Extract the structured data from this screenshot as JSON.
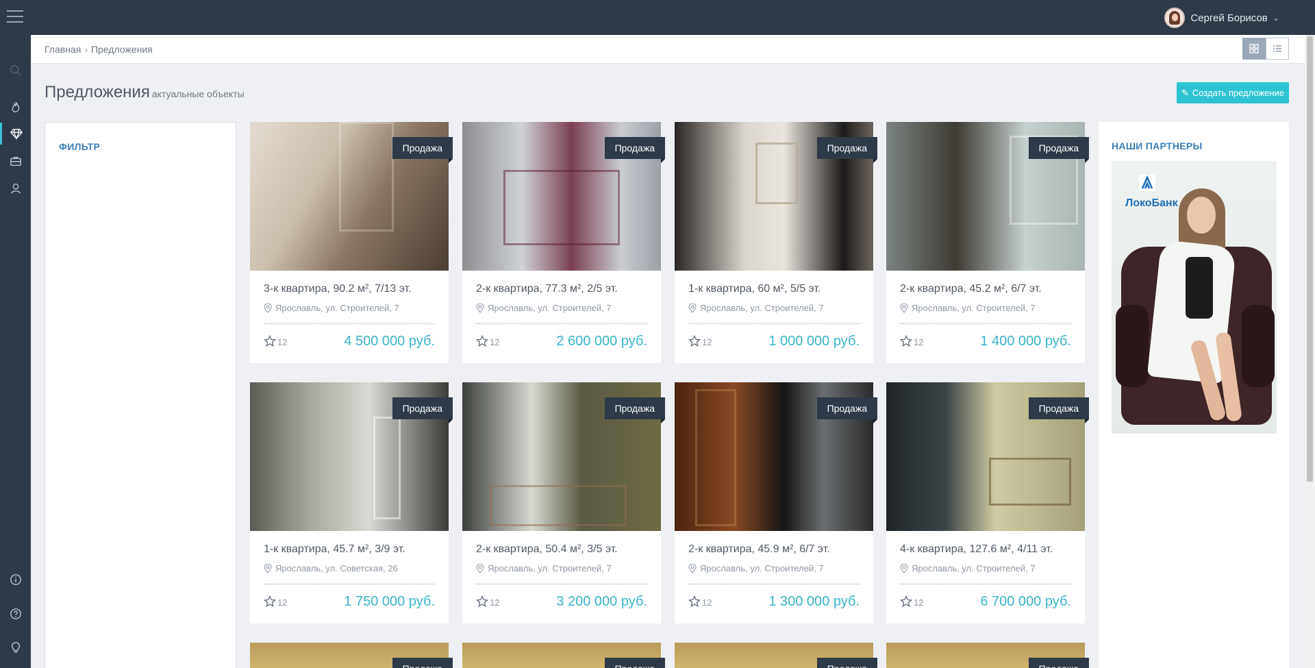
{
  "user": {
    "name": "Сергей Борисов"
  },
  "breadcrumb": {
    "home": "Главная",
    "current": "Предложения"
  },
  "page": {
    "title": "Предложения",
    "subtitle": "актуальные объекты",
    "create_label": "Создать предложение"
  },
  "filter": {
    "title": "ФИЛЬТР"
  },
  "partners": {
    "title": "НАШИ ПАРТНЕРЫ",
    "bank_name": "ЛокоБанк"
  },
  "colors": {
    "topbar": "#2e3a48",
    "accent": "#2ec3d4",
    "price": "#39b3ca",
    "heading": "#3a7fb8"
  },
  "sidebar_icons": [
    "search-icon",
    "fire-icon",
    "diamond-icon",
    "briefcase-icon",
    "contacts-icon",
    "info-icon",
    "help-icon",
    "lightbulb-icon"
  ],
  "listings": [
    {
      "badge": "Продажа",
      "title": "3-к квартира, 90.2 м², 7/13 эт.",
      "address": "Ярославль, ул. Строителей, 7",
      "favorites": "12",
      "price": "4 500 000 руб."
    },
    {
      "badge": "Продажа",
      "title": "2-к квартира, 77.3 м², 2/5 эт.",
      "address": "Ярославль, ул. Строителей, 7",
      "favorites": "12",
      "price": "2 600 000 руб."
    },
    {
      "badge": "Продажа",
      "title": "1-к квартира, 60 м², 5/5 эт.",
      "address": "Ярославль, ул. Строителей, 7",
      "favorites": "12",
      "price": "1 000 000 руб."
    },
    {
      "badge": "Продажа",
      "title": "2-к квартира, 45.2 м², 6/7 эт.",
      "address": "Ярославль, ул. Строителей, 7",
      "favorites": "12",
      "price": "1 400 000 руб."
    },
    {
      "badge": "Продажа",
      "title": "1-к квартира, 45.7 м², 3/9 эт.",
      "address": "Ярославль, ул. Советская, 26",
      "favorites": "12",
      "price": "1 750 000 руб."
    },
    {
      "badge": "Продажа",
      "title": "2-к квартира, 50.4 м², 3/5 эт.",
      "address": "Ярославль, ул. Строителей, 7",
      "favorites": "12",
      "price": "3 200 000 руб."
    },
    {
      "badge": "Продажа",
      "title": "2-к квартира, 45.9 м², 6/7 эт.",
      "address": "Ярославль, ул. Строителей, 7",
      "favorites": "12",
      "price": "1 300 000 руб."
    },
    {
      "badge": "Продажа",
      "title": "4-к квартира, 127.6 м², 4/11 эт.",
      "address": "Ярославль, ул. Строителей, 7",
      "favorites": "12",
      "price": "6 700 000 руб."
    },
    {
      "badge": "Продажа"
    },
    {
      "badge": "Продажа"
    },
    {
      "badge": "Продажа"
    },
    {
      "badge": "Продажа"
    }
  ]
}
